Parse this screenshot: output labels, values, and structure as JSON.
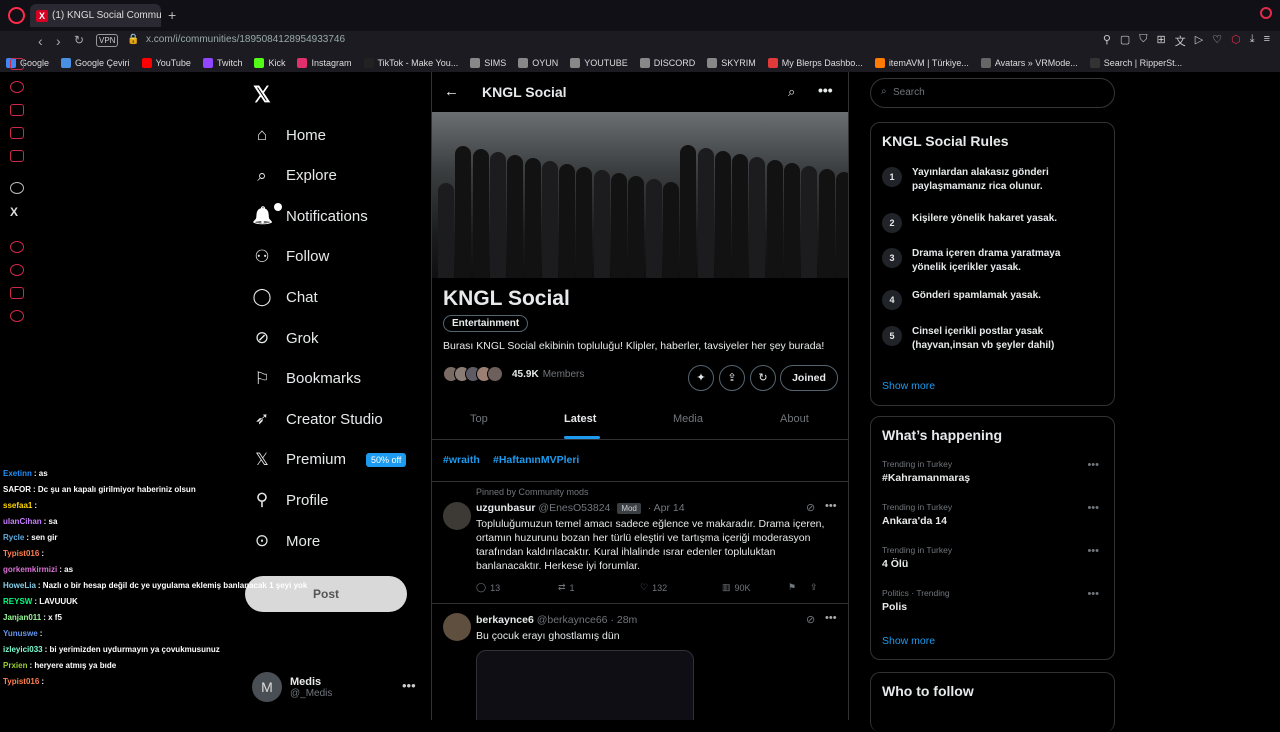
{
  "browser": {
    "tab_title": "(1) KNGL Social Communit",
    "new_tab": "+",
    "vpn": "VPN",
    "url": "x.com/i/communities/1895084128954933746",
    "bookmarks": [
      {
        "label": "Google",
        "color": "#4285f4"
      },
      {
        "label": "Google Çeviri",
        "color": "#4a90e2"
      },
      {
        "label": "YouTube",
        "color": "#ff0000"
      },
      {
        "label": "Twitch",
        "color": "#9146ff"
      },
      {
        "label": "Kick",
        "color": "#53fc18"
      },
      {
        "label": "Instagram",
        "color": "#e1306c"
      },
      {
        "label": "TikTok - Make You...",
        "color": "#222222"
      },
      {
        "label": "SIMS",
        "color": "#888888"
      },
      {
        "label": "OYUN",
        "color": "#888888"
      },
      {
        "label": "YOUTUBE",
        "color": "#888888"
      },
      {
        "label": "DISCORD",
        "color": "#888888"
      },
      {
        "label": "SKYRIM",
        "color": "#888888"
      },
      {
        "label": "My Blerps Dashbo...",
        "color": "#e03a3a"
      },
      {
        "label": "itemAVM | Türkiye...",
        "color": "#ff7a00"
      },
      {
        "label": "Avatars » VRMode...",
        "color": "#666666"
      },
      {
        "label": "Search | RipperSt...",
        "color": "#333333"
      }
    ]
  },
  "nav": {
    "items": [
      {
        "label": "Home",
        "icon": "home-icon"
      },
      {
        "label": "Explore",
        "icon": "search-icon"
      },
      {
        "label": "Notifications",
        "icon": "bell-icon"
      },
      {
        "label": "Follow",
        "icon": "follow-icon"
      },
      {
        "label": "Chat",
        "icon": "chat-icon"
      },
      {
        "label": "Grok",
        "icon": "grok-icon"
      },
      {
        "label": "Bookmarks",
        "icon": "bookmark-icon"
      },
      {
        "label": "Creator Studio",
        "icon": "rocket-icon"
      },
      {
        "label": "Premium",
        "icon": "x-icon"
      },
      {
        "label": "Profile",
        "icon": "person-icon"
      },
      {
        "label": "More",
        "icon": "more-icon"
      }
    ],
    "premium_badge": "50% off",
    "post_button": "Post",
    "account": {
      "name": "Medis",
      "handle": "@_Medis",
      "initial": "M"
    }
  },
  "community": {
    "header_title": "KNGL Social",
    "name": "KNGL Social",
    "category": "Entertainment",
    "description": "Burası KNGL Social ekibinin topluluğu! Klipler, haberler, tavsiyeler her şey burada!",
    "member_count": "45.9K",
    "members_label": "Members",
    "joined_label": "Joined",
    "tabs": [
      "Top",
      "Latest",
      "Media",
      "About"
    ],
    "active_tab": "Latest",
    "hashtags": [
      "#wraith",
      "#HaftanınMVPleri"
    ]
  },
  "posts": [
    {
      "pinned_label": "Pinned by Community mods",
      "name": "uzgunbasur",
      "handle": "@EnesO53824",
      "badge": "Mod",
      "time": "· Apr 14",
      "text": "Topluluğumuzun temel amacı sadece eğlence ve makaradır. Drama içeren, ortamın huzurunu bozan her türlü eleştiri ve tartışma içeriği moderasyon tarafından kaldırılacaktır. Kural ihlalinde ısrar edenler topluluktan banlanacaktır. Herkese iyi forumlar.",
      "replies": "13",
      "reposts": "1",
      "likes": "132",
      "views": "90K"
    },
    {
      "name": "berkaynce6",
      "handle": "@berkaynce66",
      "time": "· 28m",
      "text": "Bu çocuk erayı ghostlamış dün"
    }
  ],
  "right": {
    "search_placeholder": "Search",
    "rules_title": "KNGL Social Rules",
    "rules": [
      "Yayınlardan alakasız gönderi paylaşmamanız rica olunur.",
      "Kişilere yönelik hakaret yasak.",
      "Drama içeren drama yaratmaya yönelik içerikler yasak.",
      "Gönderi spamlamak yasak.",
      "Cinsel içerikli postlar yasak (hayvan,insan vb şeyler dahil)"
    ],
    "show_more": "Show more",
    "happening_title": "What’s happening",
    "trends": [
      {
        "meta": "Trending in Turkey",
        "name": "#Kahramanmaraş"
      },
      {
        "meta": "Trending in Turkey",
        "name": "Ankara'da 14"
      },
      {
        "meta": "Trending in Turkey",
        "name": "4 Ölü"
      },
      {
        "meta": "Politics · Trending",
        "name": "Polis"
      }
    ],
    "who_to_follow": "Who to follow"
  },
  "stream_chat": [
    {
      "user": "Exetinn",
      "msg": ": as",
      "color": "#1e90ff"
    },
    {
      "user": "SAFOR",
      "msg": ": Dc şu an kapalı girilmiyor haberiniz olsun",
      "color": "#ffffff"
    },
    {
      "user": "ssefaa1",
      "msg": ":",
      "color": "#ffd700"
    },
    {
      "user": "ulanCihan",
      "msg": ": sa",
      "color": "#c77dff"
    },
    {
      "user": "Rycle",
      "msg": ": sen gir",
      "color": "#5dade2"
    },
    {
      "user": "Typist016",
      "msg": ":",
      "color": "#ff7f50"
    },
    {
      "user": "gorkemkirmizi",
      "msg": ": as",
      "color": "#da70d6"
    },
    {
      "user": "HoweLia",
      "msg": ": Nazlı o bir hesap değil dc ye uygulama eklemiş banlanacak 1 şeyi yok",
      "color": "#87ceeb"
    },
    {
      "user": "REYSW",
      "msg": ": LAVUUUK",
      "color": "#00ff7f"
    },
    {
      "user": "Janjan011",
      "msg": ": x f5",
      "color": "#98fb98"
    },
    {
      "user": "Yunuswe",
      "msg": ":",
      "color": "#6495ed"
    },
    {
      "user": "izleyici033",
      "msg": ": bi yerimizden uydurmayın ya çovukmusunuz",
      "color": "#7fffd4"
    },
    {
      "user": "Prxien",
      "msg": ": heryere atmış ya bıde",
      "color": "#9acd32"
    },
    {
      "user": "Typist016",
      "msg": ":",
      "color": "#ff7f50"
    }
  ]
}
